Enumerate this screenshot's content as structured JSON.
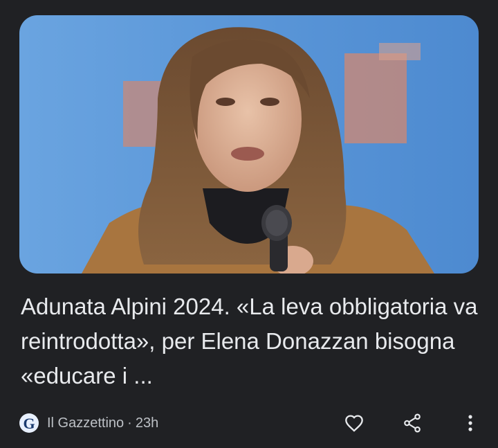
{
  "article": {
    "image_alt": "Elena Donazzan speaking into a microphone",
    "headline": "Adunata Alpini 2024. «La leva obbligatoria va reintrodotta», per Elena Donazzan bisogna «educare i ...",
    "publisher": {
      "name": "Il Gazzettino",
      "logo_letter": "G"
    },
    "separator": "·",
    "age": "23h"
  },
  "actions": {
    "like_icon": "heart-outline-icon",
    "share_icon": "share-icon",
    "more_icon": "more-vert-icon"
  },
  "colors": {
    "background": "#202124",
    "text_primary": "#e8eaed",
    "text_secondary": "#bdc1c6",
    "icon": "#e8eaed"
  }
}
